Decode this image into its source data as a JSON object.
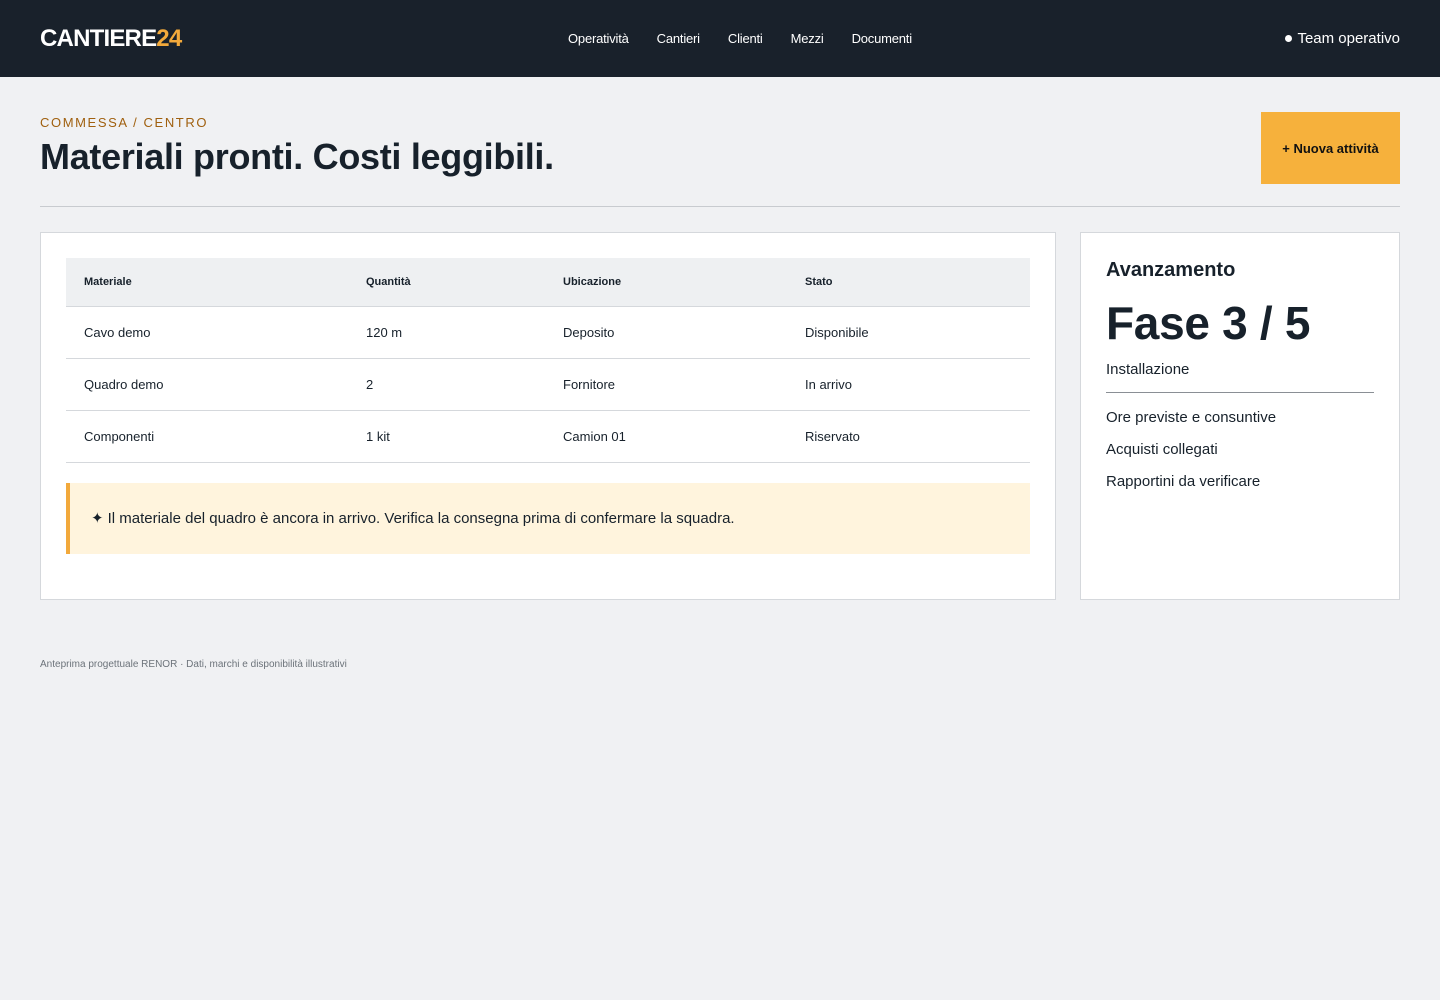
{
  "brand": {
    "name": "CANTIERE",
    "number": "24",
    "accent_color": "#f2a93b"
  },
  "nav": {
    "items": [
      "Operatività",
      "Cantieri",
      "Clienti",
      "Mezzi",
      "Documenti"
    ]
  },
  "team": {
    "label": "Team operativo",
    "icon": "dot-icon"
  },
  "header": {
    "breadcrumb": "COMMESSA / CENTRO",
    "title": "Materiali pronti. Costi leggibili.",
    "new_button": "+ Nuova attività"
  },
  "materials": {
    "columns": [
      "Materiale",
      "Quantità",
      "Ubicazione",
      "Stato"
    ],
    "rows": [
      [
        "Cavo demo",
        "120 m",
        "Deposito",
        "Disponibile"
      ],
      [
        "Quadro demo",
        "2",
        "Fornitore",
        "In arrivo"
      ],
      [
        "Componenti",
        "1 kit",
        "Camion 01",
        "Riservato"
      ]
    ]
  },
  "notice": {
    "icon": "sparkle-icon",
    "glyph": "✦",
    "text": "Il materiale del quadro è ancora in arrivo. Verifica la consegna prima di confermare la squadra."
  },
  "progress": {
    "title": "Avanzamento",
    "phase": "Fase 3 / 5",
    "phase_name": "Installazione",
    "links": [
      "Ore previste e consuntive",
      "Acquisti collegati",
      "Rapportini da verificare"
    ]
  },
  "footer": {
    "text": "Anteprima progettuale RENOR · Dati, marchi e disponibilità illustrativi"
  },
  "colors": {
    "topbar": "#19212b",
    "accent": "#f6b13c",
    "notice_bg": "#fff4dd",
    "breadcrumb": "#a0600f"
  }
}
